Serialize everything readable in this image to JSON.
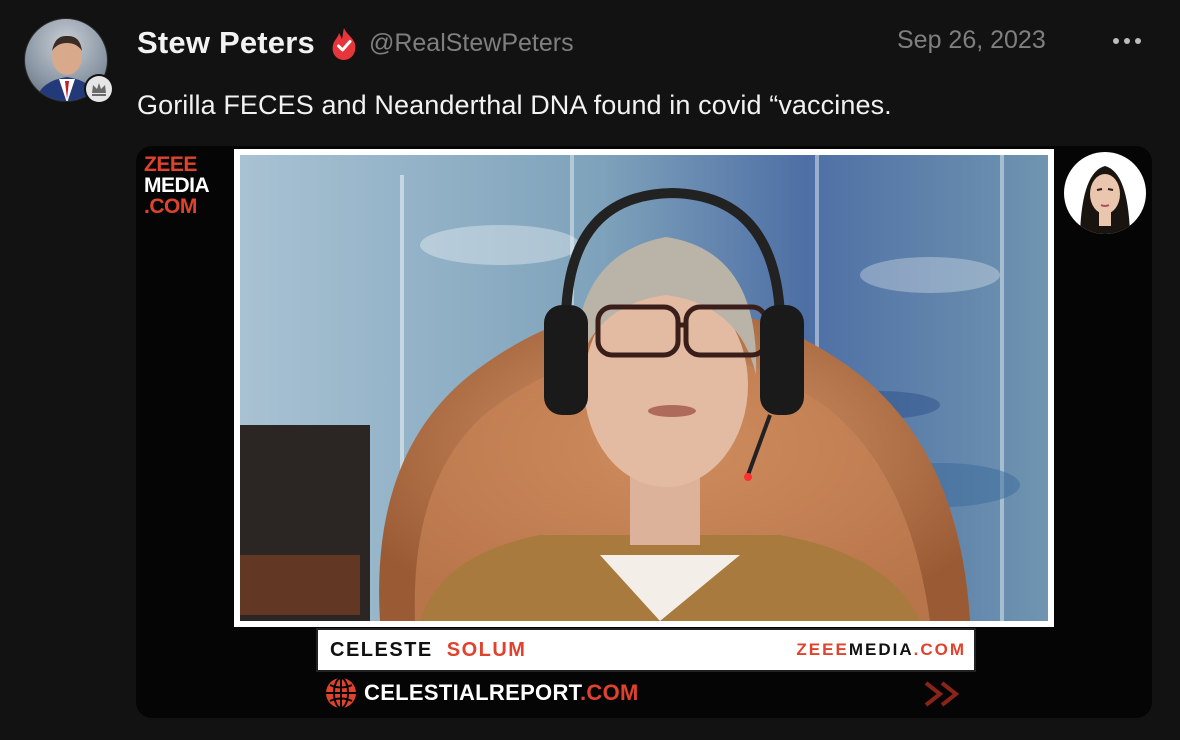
{
  "post": {
    "author_name": "Stew Peters",
    "handle": "@RealStewPeters",
    "date": "Sep 26, 2023",
    "text": "Gorilla FECES and Neanderthal DNA found in covid “vaccines."
  },
  "icons": {
    "avatar": "profile-photo",
    "badge": "crown-badge-icon",
    "verified": "flame-check-icon",
    "more": "more-dots-icon"
  },
  "media": {
    "logo_line1": "ZEEE",
    "logo_line2": "MEDIA",
    "logo_line3": ".COM",
    "lower_third_first": "CELESTE",
    "lower_third_last": "SOLUM",
    "lower_third_site_a": "ZEEE",
    "lower_third_site_b": "MEDIA",
    "lower_third_site_c": ".COM",
    "footer_site_a": "CELESTIALREPORT",
    "footer_site_b": ".COM"
  },
  "colors": {
    "background": "#121212",
    "accent_red": "#e0432d",
    "muted_text": "#7f7f7f"
  }
}
